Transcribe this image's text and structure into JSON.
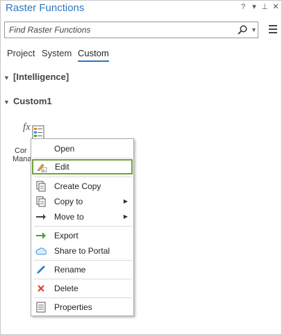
{
  "pane": {
    "title": "Raster Functions",
    "controls": {
      "help": "?",
      "options": "▾",
      "pin": "⊥",
      "close": "✕"
    }
  },
  "search": {
    "placeholder": "Find Raster Functions"
  },
  "tabs": [
    {
      "label": "Project",
      "active": false
    },
    {
      "label": "System",
      "active": false
    },
    {
      "label": "Custom",
      "active": true
    }
  ],
  "groups": [
    {
      "label": "[Intelligence]",
      "expanded": true
    },
    {
      "label": "Custom1",
      "expanded": true
    }
  ],
  "item": {
    "label_line1": "Cor",
    "label_line2": "Mana"
  },
  "context_menu": {
    "items": {
      "open": "Open",
      "edit": "Edit",
      "create_copy": "Create Copy",
      "copy_to": "Copy to",
      "move_to": "Move to",
      "export": "Export",
      "share": "Share to Portal",
      "rename": "Rename",
      "delete": "Delete",
      "properties": "Properties"
    },
    "highlighted": "Edit",
    "highlight_color": "#6da13a"
  },
  "colors": {
    "accent": "#2b78bd",
    "delete": "#d9432f",
    "export": "#4aa33b"
  }
}
